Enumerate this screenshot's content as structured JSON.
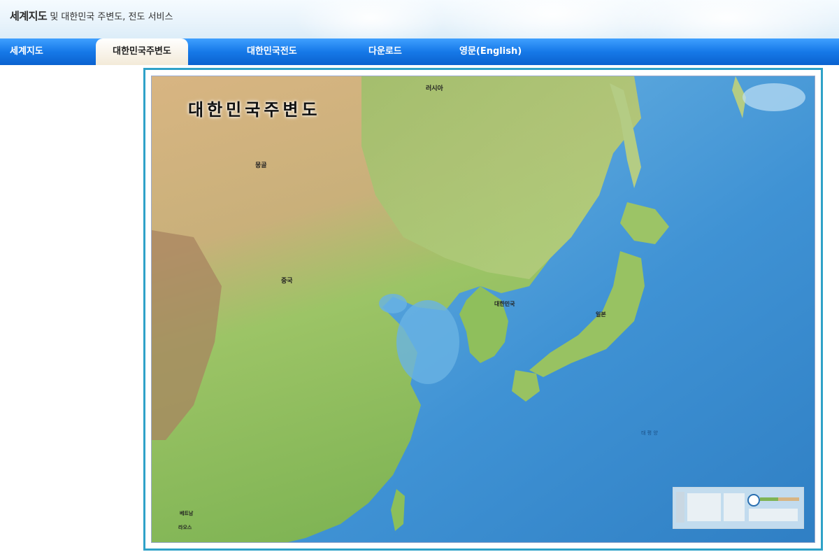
{
  "header": {
    "title_strong": "세계지도",
    "title_rest": " 및 대한민국 주변도, 전도 서비스"
  },
  "nav": {
    "items": [
      {
        "label": "세계지도",
        "active": false
      },
      {
        "label": "대한민국주변도",
        "active": true
      },
      {
        "label": "대한민국전도",
        "active": false
      },
      {
        "label": "다운로드",
        "active": false
      },
      {
        "label": "영문(English)",
        "active": false
      }
    ]
  },
  "map": {
    "title": "대한민국주변도",
    "labels": {
      "russia": "러시아",
      "mongolia": "몽골",
      "china": "중국",
      "korea": "대한민국",
      "japan": "일본",
      "vietnam": "베트남",
      "laos": "라오스",
      "pacific": "태 평 양"
    }
  },
  "colors": {
    "nav_blue": "#1679e8",
    "frame_border": "#2fa2c8",
    "sea": "#3b8fd2",
    "land_green": "#8cbf5a",
    "land_tan": "#d4b07a"
  }
}
